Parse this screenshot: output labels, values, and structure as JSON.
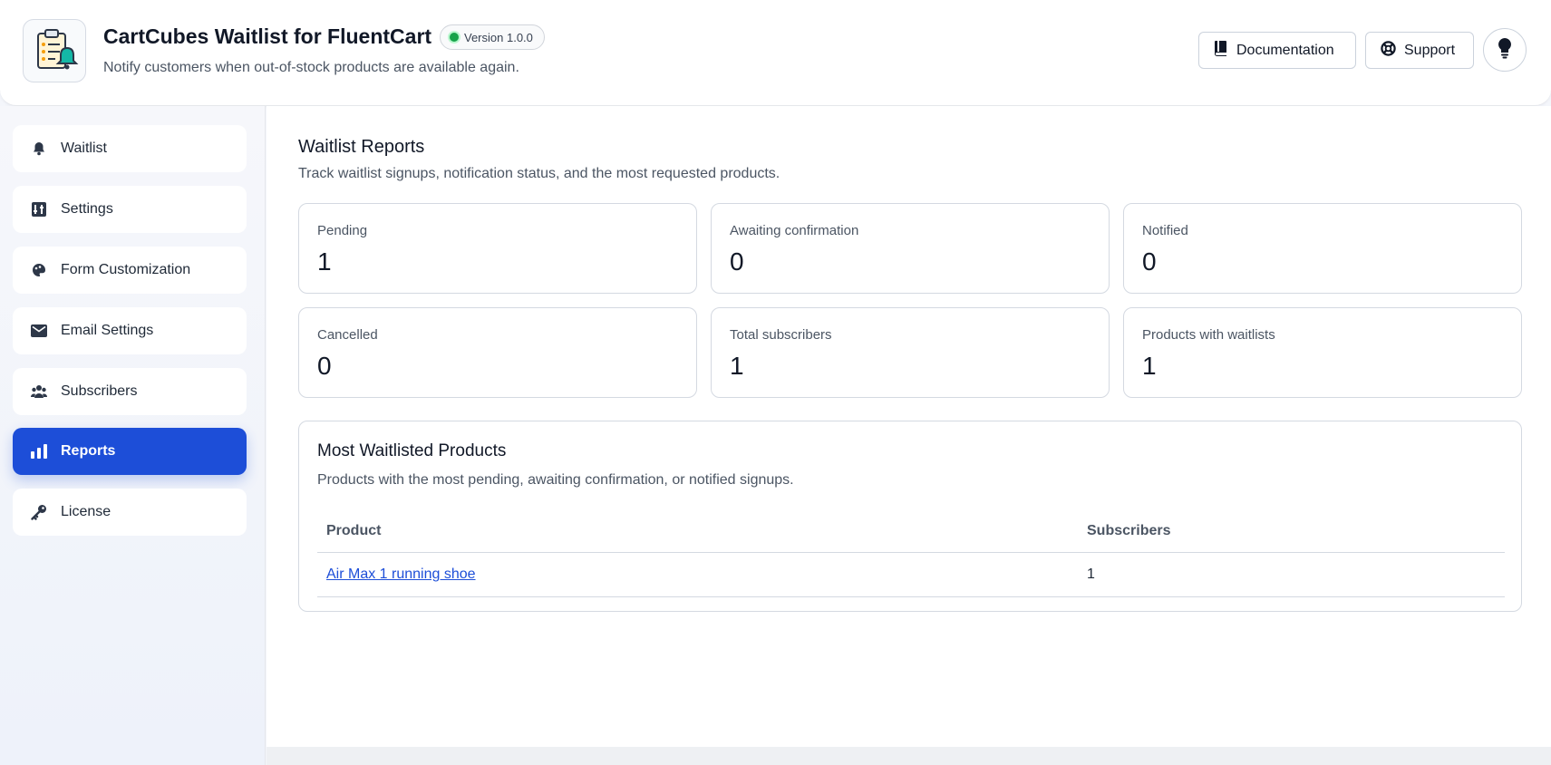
{
  "header": {
    "title": "CartCubes Waitlist for FluentCart",
    "version": "Version 1.0.0",
    "subtitle": "Notify customers when out-of-stock products are available again.",
    "docs_label": "Documentation",
    "support_label": "Support",
    "logo_icon": "clipboard-bell-icon",
    "theme_icon": "lightbulb-icon"
  },
  "sidebar": {
    "items": [
      {
        "label": "Waitlist",
        "icon": "bell-icon"
      },
      {
        "label": "Settings",
        "icon": "sliders-icon"
      },
      {
        "label": "Form Customization",
        "icon": "palette-icon"
      },
      {
        "label": "Email Settings",
        "icon": "envelope-icon"
      },
      {
        "label": "Subscribers",
        "icon": "users-icon"
      },
      {
        "label": "Reports",
        "icon": "bar-chart-icon",
        "active": true
      },
      {
        "label": "License",
        "icon": "key-icon"
      }
    ]
  },
  "main": {
    "title": "Waitlist Reports",
    "description": "Track waitlist signups, notification status, and the most requested products.",
    "stats": [
      {
        "label": "Pending",
        "value": "1"
      },
      {
        "label": "Awaiting confirmation",
        "value": "0"
      },
      {
        "label": "Notified",
        "value": "0"
      },
      {
        "label": "Cancelled",
        "value": "0"
      },
      {
        "label": "Total subscribers",
        "value": "1"
      },
      {
        "label": "Products with waitlists",
        "value": "1"
      }
    ],
    "products": {
      "title": "Most Waitlisted Products",
      "description": "Products with the most pending, awaiting confirmation, or notified signups.",
      "columns": [
        "Product",
        "Subscribers"
      ],
      "rows": [
        {
          "product": "Air Max 1 running shoe",
          "subscribers": "1"
        }
      ]
    }
  },
  "colors": {
    "accent": "#1d4ed8",
    "status_dot": "#16a34a"
  }
}
